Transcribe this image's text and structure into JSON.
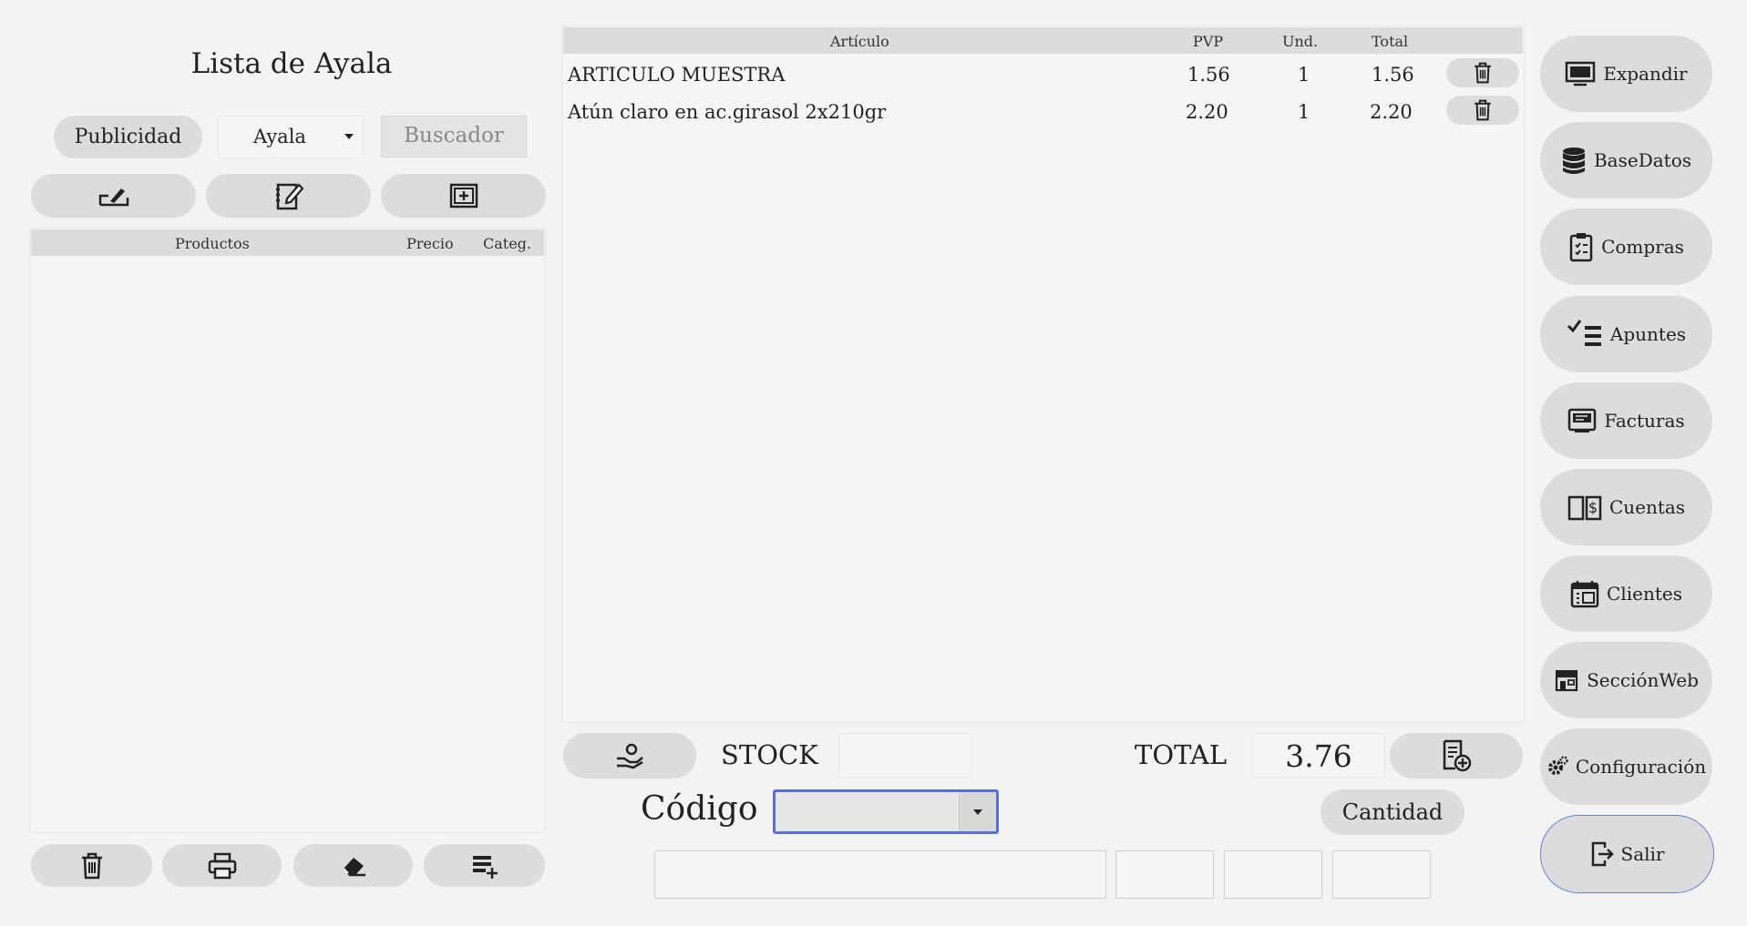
{
  "left_panel": {
    "title": "Lista de Ayala",
    "publicidad_label": "Publicidad",
    "list_select_value": "Ayala",
    "search_placeholder": "Buscador",
    "products_table": {
      "headers": [
        "Productos",
        "Precio",
        "Categ."
      ],
      "rows": []
    }
  },
  "ticket": {
    "headers": [
      "Artículo",
      "PVP",
      "Und.",
      "Total"
    ],
    "rows": [
      {
        "articulo": "ARTICULO MUESTRA",
        "pvp": "1.56",
        "und": "1",
        "total": "1.56"
      },
      {
        "articulo": "Atún claro en ac.girasol 2x210gr",
        "pvp": "2.20",
        "und": "1",
        "total": "2.20"
      }
    ]
  },
  "bottom": {
    "stock_label": "STOCK",
    "stock_value": "",
    "total_label": "TOTAL",
    "total_value": "3.76",
    "codigo_label": "Código",
    "codigo_value": "",
    "cantidad_label": "Cantidad"
  },
  "sidebar": {
    "items": [
      {
        "label": "Expandir",
        "icon": "monitor-icon"
      },
      {
        "label": "BaseDatos",
        "icon": "database-icon"
      },
      {
        "label": "Compras",
        "icon": "clipboard-icon"
      },
      {
        "label": "Apuntes",
        "icon": "checklist-icon"
      },
      {
        "label": "Facturas",
        "icon": "invoice-icon"
      },
      {
        "label": "Cuentas",
        "icon": "ledger-icon"
      },
      {
        "label": "Clientes",
        "icon": "calendar-icon"
      },
      {
        "label": "SecciónWeb",
        "icon": "store-icon"
      },
      {
        "label": "Configuración",
        "icon": "gears-icon"
      },
      {
        "label": "Salir",
        "icon": "exit-icon"
      }
    ]
  },
  "colors": {
    "background": "#f3f3f3",
    "button": "#dcdcdc",
    "focus_border": "#5b6fd8",
    "salir_border": "#6a7fe0"
  }
}
